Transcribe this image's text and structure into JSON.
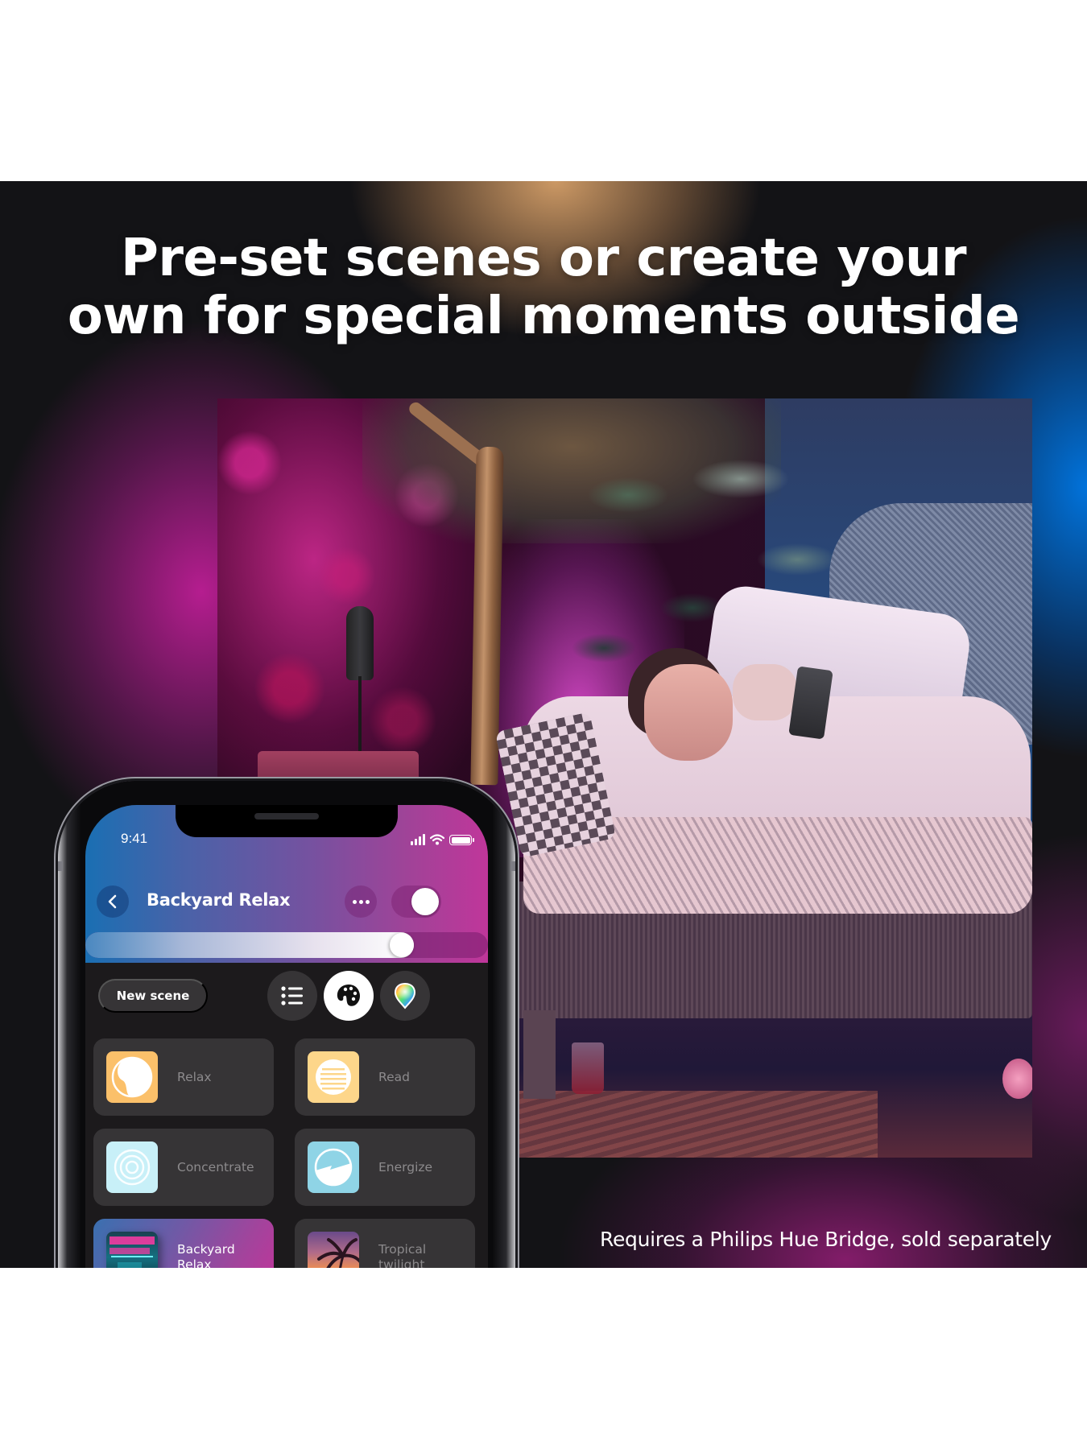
{
  "banner": {
    "headline_lines": [
      "Pre-set scenes or create your",
      "own for special moments outside"
    ],
    "footnote": "Requires a Philips Hue Bridge, sold separately",
    "photo_description": "Woman relaxing on a wicker outdoor sofa at night, garden lit with pink, purple and blue smart lights"
  },
  "app": {
    "status_bar": {
      "time": "9:41",
      "signal_icon": "cellular-signal-icon",
      "wifi_icon": "wifi-icon",
      "battery_icon": "battery-icon"
    },
    "header": {
      "back_icon": "chevron-left-icon",
      "title": "Backyard Relax",
      "more_icon": "more-horizontal-icon",
      "power_on": true
    },
    "brightness": {
      "value_percent": 80
    },
    "toolbar": {
      "new_scene_label": "New scene",
      "views": [
        {
          "name": "list-view",
          "icon": "list-icon",
          "active": false
        },
        {
          "name": "scene-gallery-view",
          "icon": "palette-icon",
          "active": true
        },
        {
          "name": "color-picker-view",
          "icon": "color-wheel-pin-icon",
          "active": false
        }
      ]
    },
    "scenes": [
      {
        "label": "Relax",
        "icon": "relax-yin-yang-icon",
        "selected": false
      },
      {
        "label": "Read",
        "icon": "read-lines-icon",
        "selected": false
      },
      {
        "label": "Concentrate",
        "icon": "concentrate-rings-icon",
        "selected": false
      },
      {
        "label": "Energize",
        "icon": "energize-bolt-icon",
        "selected": false
      },
      {
        "label": "Backyard\nRelax",
        "icon": "neon-sign-photo",
        "selected": true
      },
      {
        "label": "Tropical\ntwilight",
        "icon": "palm-sunset-photo",
        "selected": false
      }
    ]
  },
  "colors": {
    "panel_bg": "#131316",
    "accent_blue": "#1a6fb3",
    "accent_magenta": "#c0369a",
    "tile_bg": "#363436",
    "relax_icon": "#fbc06a",
    "read_icon": "#fdd68a",
    "concentrate_icon": "#c8f0f8",
    "energize_icon": "#8fd4e6"
  }
}
